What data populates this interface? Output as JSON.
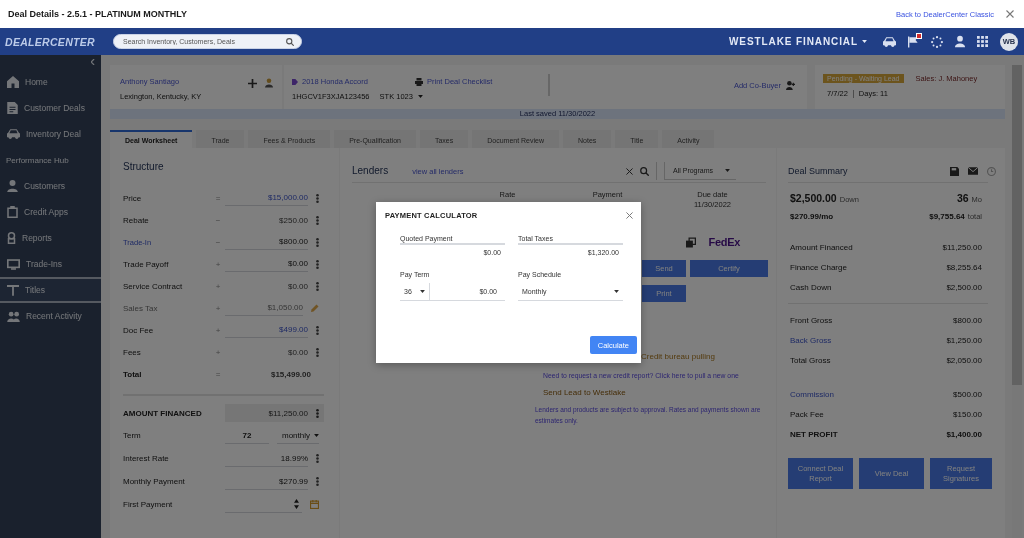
{
  "browser_bar": {
    "title": "Deal Details - 2.5.1 - PLATINUM MONTHLY",
    "link": "Back to DealerCenter Classic"
  },
  "navbar": {
    "logo": "DEALERCENTER",
    "search": {
      "placeholder": "Search Inventory, Customers, Deals"
    },
    "account": "WESTLAKE FINANCIAL",
    "alert": true,
    "avatar": "WB"
  },
  "sidebar": {
    "items": [
      {
        "label": "Home",
        "kind": "link",
        "selected": false
      },
      {
        "label": "Customer Deals",
        "kind": "link",
        "selected": false
      },
      {
        "label": "Inventory Deal",
        "kind": "link",
        "selected": false
      },
      {
        "label": "Performance Hub",
        "kind": "section",
        "selected": false
      },
      {
        "label": "Customers",
        "kind": "link",
        "selected": false
      },
      {
        "label": "Credit Apps",
        "kind": "link",
        "selected": false
      },
      {
        "label": "Reports",
        "kind": "link",
        "selected": false
      },
      {
        "label": "Trade-Ins",
        "kind": "link",
        "selected": false
      },
      {
        "label": "Titles",
        "kind": "link",
        "selected": true
      },
      {
        "label": "Recent Activity",
        "kind": "link",
        "selected": false
      }
    ]
  },
  "deal_header": {
    "customer": {
      "name": "Anthony Santiago",
      "location": "Lexington, Kentucky, KY"
    },
    "vehicle": {
      "title": "2018 Honda Accord",
      "vin": "1HGCV1F3XJA123456",
      "stock": "STK 1023"
    },
    "checklist_link": "Print Deal Checklist",
    "co_buyer_link": "Add Co-Buyer",
    "status": {
      "badge": "Pending - Waiting Lead",
      "salesperson": "Sales: J. Mahoney",
      "date": "7/7/22",
      "days": "Days: 11"
    }
  },
  "saved_strip": "Last saved 11/30/2022",
  "tabs": [
    {
      "label": "Deal Worksheet",
      "selected": true
    },
    {
      "label": "Trade",
      "selected": false
    },
    {
      "label": "Fees & Products",
      "selected": false
    },
    {
      "label": "Pre-Qualification",
      "selected": false
    },
    {
      "label": "Taxes",
      "selected": false
    },
    {
      "label": "Document Review",
      "selected": false
    },
    {
      "label": "Notes",
      "selected": false
    },
    {
      "label": "Title",
      "selected": false
    },
    {
      "label": "Activity",
      "selected": false
    }
  ],
  "structure": {
    "title": "Structure",
    "rows": [
      {
        "label": "Price",
        "op": "=",
        "value": "$15,000.00",
        "kind": "selector"
      },
      {
        "label": "Rebate",
        "op": "−",
        "value": "$250.00",
        "kind": "plain"
      },
      {
        "label": "Trade-In",
        "op": "−",
        "value": "$800.00",
        "kind": "link"
      },
      {
        "label": "Trade Payoff",
        "op": "+",
        "value": "$0.00",
        "kind": "input"
      },
      {
        "label": "Service Contract",
        "op": "+",
        "value": "$0.00",
        "kind": "plain"
      },
      {
        "label": "Sales Tax",
        "op": "+",
        "value": "$1,050.00",
        "kind": "locked"
      },
      {
        "label": "Doc Fee",
        "op": "+",
        "value": "$499.00",
        "kind": "selector"
      },
      {
        "label": "Fees",
        "op": "+",
        "value": "$0.00",
        "kind": "plain"
      },
      {
        "label": "Total",
        "op": "=",
        "value": "$15,499.00",
        "kind": "total"
      }
    ]
  },
  "financing": {
    "title": "AMOUNT FINANCED",
    "amount": "$11,250.00",
    "rows": [
      {
        "label": "Term",
        "kind": "term",
        "value": "72",
        "option": "monthly"
      },
      {
        "label": "Interest Rate",
        "kind": "input",
        "value": "18.99%"
      },
      {
        "label": "Monthly Payment",
        "kind": "input",
        "value": "$270.99"
      },
      {
        "label": "First Payment",
        "kind": "date"
      }
    ]
  },
  "lenders": {
    "title": "Lenders",
    "link": "view all lenders",
    "filter": "All Programs",
    "columns": [
      {
        "label": "Rate"
      },
      {
        "label": "Payment"
      },
      {
        "label": "Due date",
        "value": "11/30/2022"
      }
    ],
    "logo": "FedEx",
    "buttons": [
      "Send",
      "Certify",
      "Print"
    ],
    "status": "Credit bureau pulling",
    "credit_link": "Need to request a new credit report? Click here to pull a new one",
    "lead_link": "Send Lead to Westlake",
    "disclaimer": "Lenders and products are subject to approval. Rates and payments shown are estimates only."
  },
  "summary": {
    "title": "Deal Summary",
    "down": {
      "value": "$2,500.00",
      "unit": "Down"
    },
    "term": {
      "value": "36",
      "unit": "Mo"
    },
    "payment": "$270.99/mo",
    "total": {
      "value": "$9,755.64",
      "unit": "total"
    },
    "sections": [
      {
        "rows": [
          {
            "label": "Amount Financed",
            "value": "$11,250.00",
            "kind": "text"
          },
          {
            "label": "Finance Charge",
            "value": "$8,255.64",
            "kind": "text"
          },
          {
            "label": "Cash Down",
            "value": "$2,500.00",
            "kind": "text"
          }
        ]
      },
      {
        "rows": [
          {
            "label": "Front Gross",
            "value": "$800.00",
            "kind": "text"
          },
          {
            "label": "Back Gross",
            "value": "$1,250.00",
            "kind": "link"
          },
          {
            "label": "Total Gross",
            "value": "$2,050.00",
            "kind": "text"
          }
        ]
      },
      {
        "rows": [
          {
            "label": "Commission",
            "value": "$500.00",
            "kind": "link"
          },
          {
            "label": "Pack Fee",
            "value": "$150.00",
            "kind": "text"
          },
          {
            "label": "NET PROFIT",
            "value": "$1,400.00",
            "kind": "total"
          }
        ]
      }
    ],
    "buttons": [
      "Connect Deal Report",
      "View Deal",
      "Request Signatures"
    ]
  },
  "modal": {
    "title": "PAYMENT CALCULATOR",
    "fields": [
      {
        "label": "Quoted Payment",
        "kind": "input",
        "value": "$0.00"
      },
      {
        "label": "Total Taxes",
        "kind": "input",
        "value": "$1,320.00"
      },
      {
        "label": "Pay Term",
        "kind": "term",
        "option": "36",
        "value": "$0.00"
      },
      {
        "label": "Pay Schedule",
        "kind": "select",
        "option": "Monthly"
      }
    ],
    "button": "Calculate"
  }
}
